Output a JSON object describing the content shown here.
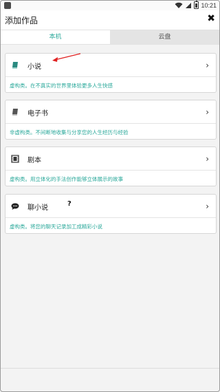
{
  "status_bar": {
    "time": "10:21"
  },
  "header": {
    "title": "添加作品",
    "close_glyph": "✖"
  },
  "tabs": [
    {
      "label": "本机",
      "active": true
    },
    {
      "label": "云盘",
      "active": false
    }
  ],
  "items": [
    {
      "name": "小说",
      "description": "虚构类。在不真实的世界里体验更多人生快感",
      "icon": "book-icon"
    },
    {
      "name": "电子书",
      "description": "非虚构类。不间断地收集与分享您的人生经历与经验",
      "icon": "ebook-icon"
    },
    {
      "name": "剧本",
      "description": "虚构类。用立体化的手法创作能够立体展示的故事",
      "icon": "film-icon"
    },
    {
      "name": "聊小说",
      "description": "虚构类。将您的聊天记录加工成精彩小说",
      "icon": "chat-icon",
      "help": "?"
    }
  ],
  "chevron": "›",
  "colors": {
    "accent": "#2aa89a",
    "annotation_arrow": "#e02020"
  }
}
